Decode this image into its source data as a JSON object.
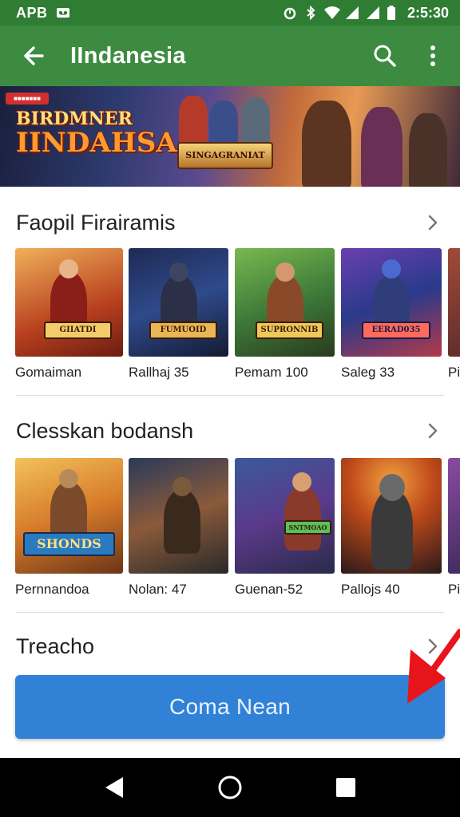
{
  "status_bar": {
    "left_text": "APB",
    "time": "2:5:30",
    "icons": [
      "voicemail-icon",
      "alarm-icon",
      "bluetooth-icon",
      "wifi-icon",
      "signal-icon",
      "signal-icon",
      "battery-icon"
    ]
  },
  "app_bar": {
    "title": "IIndanesia",
    "back_icon": "arrow-left-icon",
    "search_icon": "search-icon",
    "more_icon": "more-vert-icon"
  },
  "banner": {
    "badge": "■■■■■■■",
    "title_line1": "BIRDMNER",
    "title_line2": "IINDAHSA",
    "logo_text": "SINGAGRANIAT"
  },
  "sections": [
    {
      "title": "Faopil Firairamis",
      "items": [
        {
          "label": "Gomaiman",
          "tag": "GIIATDI"
        },
        {
          "label": "Rallhaj 35",
          "tag": "FUMUOID"
        },
        {
          "label": "Pemam 100",
          "tag": "SUPRONNIB"
        },
        {
          "label": "Saleg 33",
          "tag": "EERAD035"
        },
        {
          "label": "Pi",
          "tag": ""
        }
      ]
    },
    {
      "title": "Clesskan bodansh",
      "items": [
        {
          "label": "Pernnandoa",
          "tag": "SHONDS"
        },
        {
          "label": "Nolan: 47",
          "tag": ""
        },
        {
          "label": "Guenan-52",
          "tag": "SNTMOAO"
        },
        {
          "label": "Pallojs 40",
          "tag": ""
        },
        {
          "label": "Pi",
          "tag": ""
        }
      ]
    },
    {
      "title": "Treacho",
      "items": []
    }
  ],
  "cta": {
    "label": "Coma Nean"
  },
  "nav_bar": {
    "back_icon": "nav-back-icon",
    "home_icon": "nav-home-icon",
    "recents_icon": "nav-recents-icon"
  },
  "colors": {
    "status_bar": "#2e7d32",
    "app_bar": "#3d8b40",
    "cta": "#3182d6",
    "arrow": "#e8141b"
  }
}
